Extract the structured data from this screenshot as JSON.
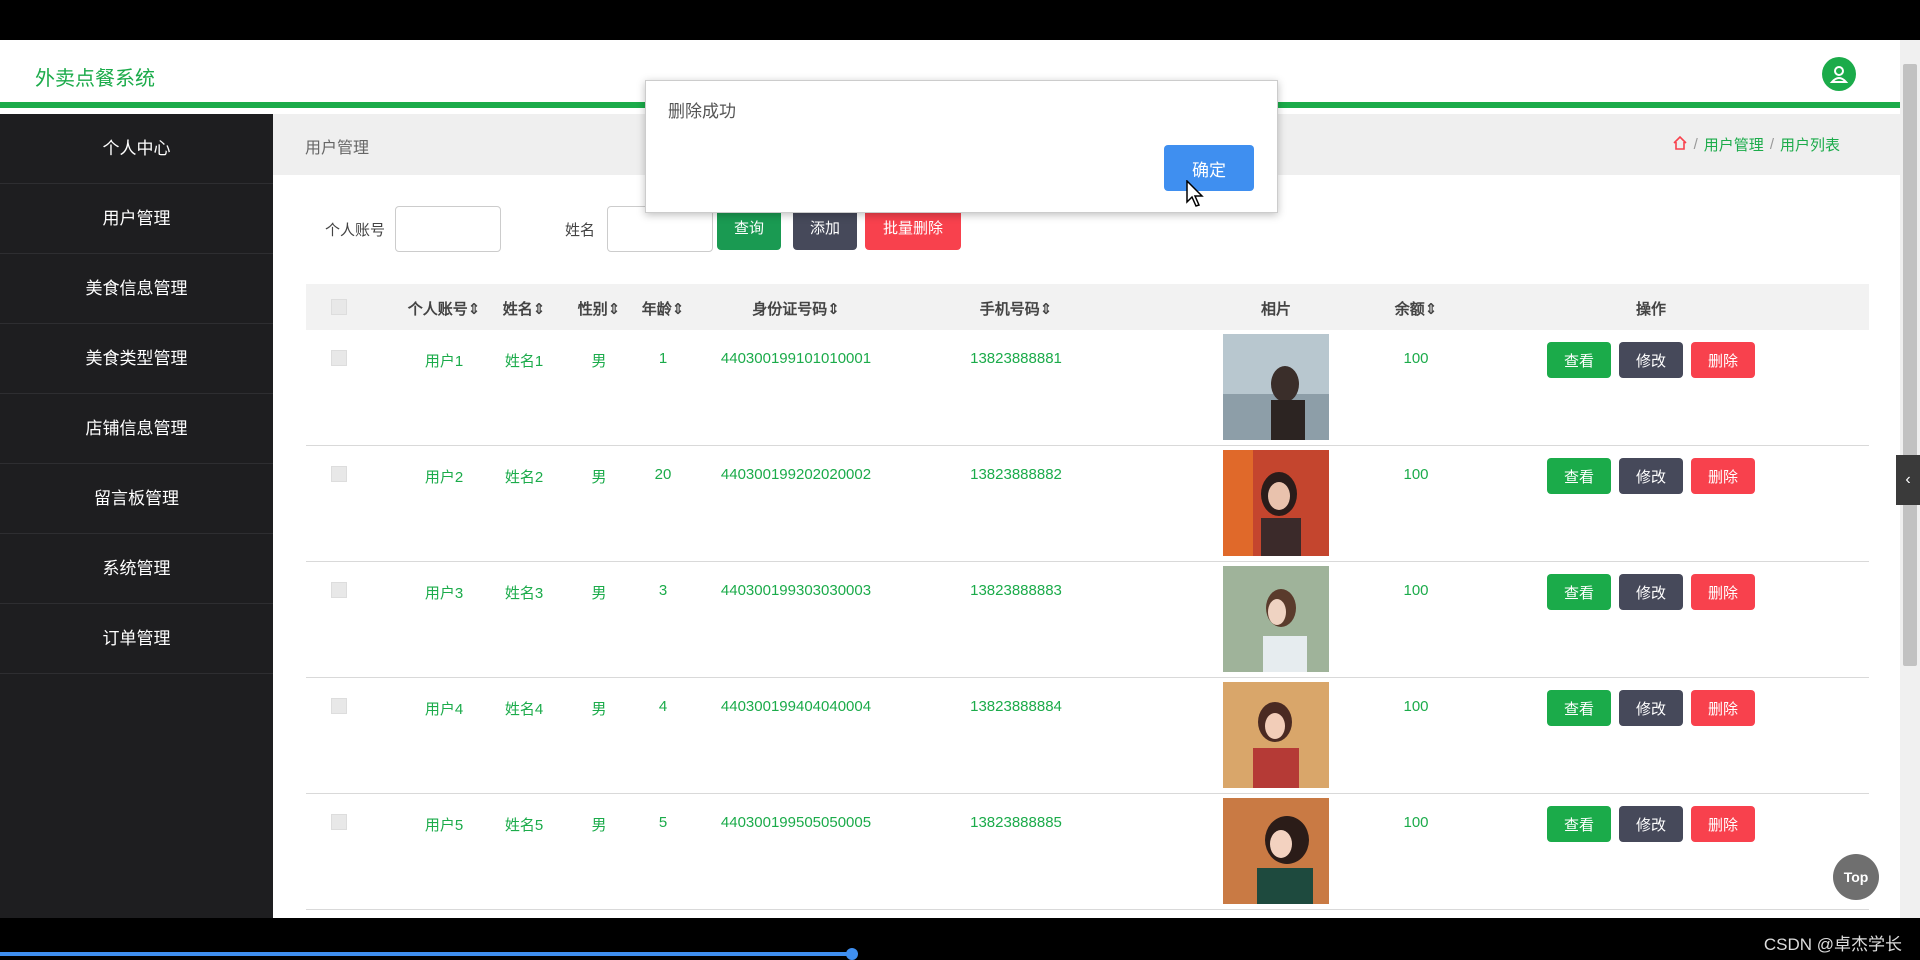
{
  "header": {
    "brand": "外卖点餐系统"
  },
  "sidebar": {
    "items": [
      {
        "label": "个人中心"
      },
      {
        "label": "用户管理"
      },
      {
        "label": "美食信息管理"
      },
      {
        "label": "美食类型管理"
      },
      {
        "label": "店铺信息管理"
      },
      {
        "label": "留言板管理"
      },
      {
        "label": "系统管理"
      },
      {
        "label": "订单管理"
      }
    ]
  },
  "breadcrumb": {
    "title": "用户管理",
    "path": [
      "用户管理",
      "用户列表"
    ],
    "sep": "/"
  },
  "search": {
    "account_label": "个人账号",
    "account_value": "",
    "name_label": "姓名",
    "name_value": "",
    "query_label": "查询",
    "add_label": "添加",
    "batch_delete_label": "批量删除"
  },
  "table": {
    "headers": {
      "account": "个人账号",
      "name": "姓名",
      "gender": "性别",
      "age": "年龄",
      "idcard": "身份证号码",
      "phone": "手机号码",
      "photo": "相片",
      "balance": "余额",
      "ops": "操作"
    },
    "sort_icon": "⇕",
    "actions": {
      "view": "查看",
      "edit": "修改",
      "delete": "删除"
    },
    "rows": [
      {
        "account": "用户1",
        "name": "姓名1",
        "gender": "男",
        "age": "1",
        "idcard": "440300199101010001",
        "phone": "13823888881",
        "balance": "100"
      },
      {
        "account": "用户2",
        "name": "姓名2",
        "gender": "男",
        "age": "20",
        "idcard": "440300199202020002",
        "phone": "13823888882",
        "balance": "100"
      },
      {
        "account": "用户3",
        "name": "姓名3",
        "gender": "男",
        "age": "3",
        "idcard": "440300199303030003",
        "phone": "13823888883",
        "balance": "100"
      },
      {
        "account": "用户4",
        "name": "姓名4",
        "gender": "男",
        "age": "4",
        "idcard": "440300199404040004",
        "phone": "13823888884",
        "balance": "100"
      },
      {
        "account": "用户5",
        "name": "姓名5",
        "gender": "男",
        "age": "5",
        "idcard": "440300199505050005",
        "phone": "13823888885",
        "balance": "100"
      }
    ]
  },
  "dialog": {
    "message": "删除成功",
    "ok_label": "确定"
  },
  "top_button": "Top",
  "watermark": "CSDN @卓杰学长",
  "colors": {
    "accent": "#1bab4a",
    "danger": "#f8414d",
    "dark": "#46495a",
    "primary": "#3f8ff0"
  }
}
